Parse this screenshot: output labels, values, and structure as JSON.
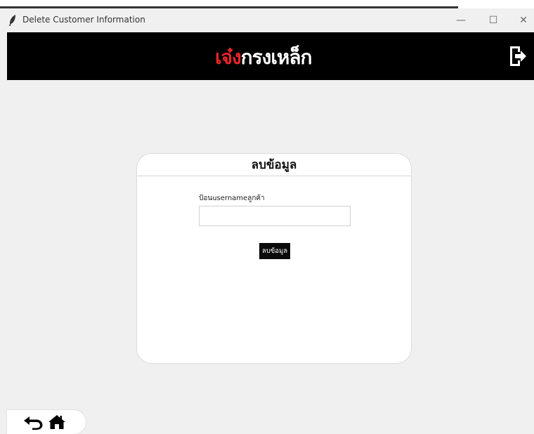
{
  "window": {
    "title": "Delete Customer Information",
    "icon": "feather-icon",
    "controls": {
      "minimize": "—",
      "maximize": "☐",
      "close": "✕"
    }
  },
  "header": {
    "brand_red": "เจ๋ง",
    "brand_white": "กรงเหล็ก",
    "logout_icon": "logout-icon",
    "background_color": "#000000",
    "brand_color": "#e8252b"
  },
  "card": {
    "title": "ลบข้อมูล",
    "field_label": "ป้อนusernameลูกค้า",
    "field_value": "",
    "submit_label": "ลบข้อมูล"
  },
  "nav": {
    "back_icon": "back-arrow-icon",
    "home_icon": "home-icon"
  }
}
